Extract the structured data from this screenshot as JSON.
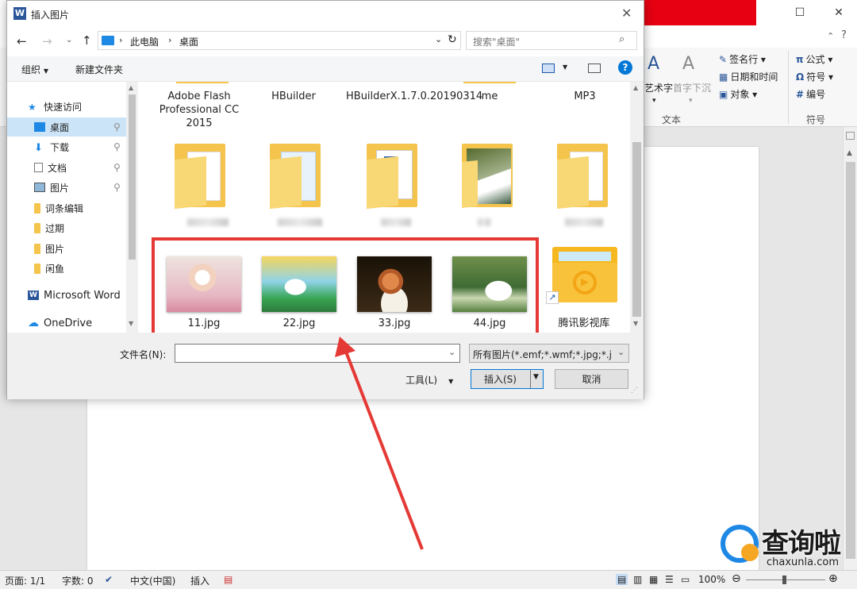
{
  "word": {
    "ribbon": {
      "wordart_label": "艺术字",
      "dropcap_label": "首字下沉",
      "group_text": "文本",
      "group_symbols": "符号",
      "items": [
        "签名行",
        "日期和时间",
        "对象"
      ],
      "symbols": [
        "公式",
        "符号",
        "编号"
      ]
    },
    "status": {
      "page": "页面: 1/1",
      "words": "字数: 0",
      "lang": "中文(中国)",
      "insert_mode": "插入",
      "zoom": "100%"
    }
  },
  "dialog": {
    "title": "插入图片",
    "breadcrumb": [
      "此电脑",
      "桌面"
    ],
    "search_placeholder": "搜索\"桌面\"",
    "toolbar": {
      "organize": "组织",
      "new_folder": "新建文件夹"
    },
    "nav": [
      {
        "label": "快速访问",
        "icon": "star-icon"
      },
      {
        "label": "桌面",
        "icon": "desktop-icon",
        "pinned": true,
        "selected": true
      },
      {
        "label": "下载",
        "icon": "download-icon",
        "pinned": true
      },
      {
        "label": "文档",
        "icon": "document-icon",
        "pinned": true
      },
      {
        "label": "图片",
        "icon": "pictures-icon",
        "pinned": true
      },
      {
        "label": "词条编辑",
        "icon": "folder-icon"
      },
      {
        "label": "过期",
        "icon": "folder-icon"
      },
      {
        "label": "图片",
        "icon": "folder-icon"
      },
      {
        "label": "闲鱼",
        "icon": "folder-icon"
      },
      {
        "label": "Microsoft Word",
        "icon": "word-icon"
      },
      {
        "label": "OneDrive",
        "icon": "cloud-icon"
      }
    ],
    "files_row1": [
      {
        "name": "Adobe Flash Professional CC 2015"
      },
      {
        "name": "HBuilder"
      },
      {
        "name": "HBuilderX.1.7.0.20190314"
      },
      {
        "name": "me"
      },
      {
        "name": "MP3"
      }
    ],
    "files_row3": [
      {
        "name": "11.jpg"
      },
      {
        "name": "22.jpg"
      },
      {
        "name": "33.jpg"
      },
      {
        "name": "44.jpg"
      },
      {
        "name": "腾讯影视库"
      }
    ],
    "filename_label": "文件名(N):",
    "filename_value": "",
    "filter_value": "所有图片(*.emf;*.wmf;*.jpg;*.j",
    "tools_label": "工具(L)",
    "insert_label": "插入(S)",
    "cancel_label": "取消"
  },
  "watermark": {
    "text": "查询啦",
    "url": "chaxunla.com"
  },
  "colors": {
    "highlight": "#e53935",
    "accent": "#0078d7",
    "word_blue": "#2b579a",
    "brand_red": "#e60012"
  }
}
